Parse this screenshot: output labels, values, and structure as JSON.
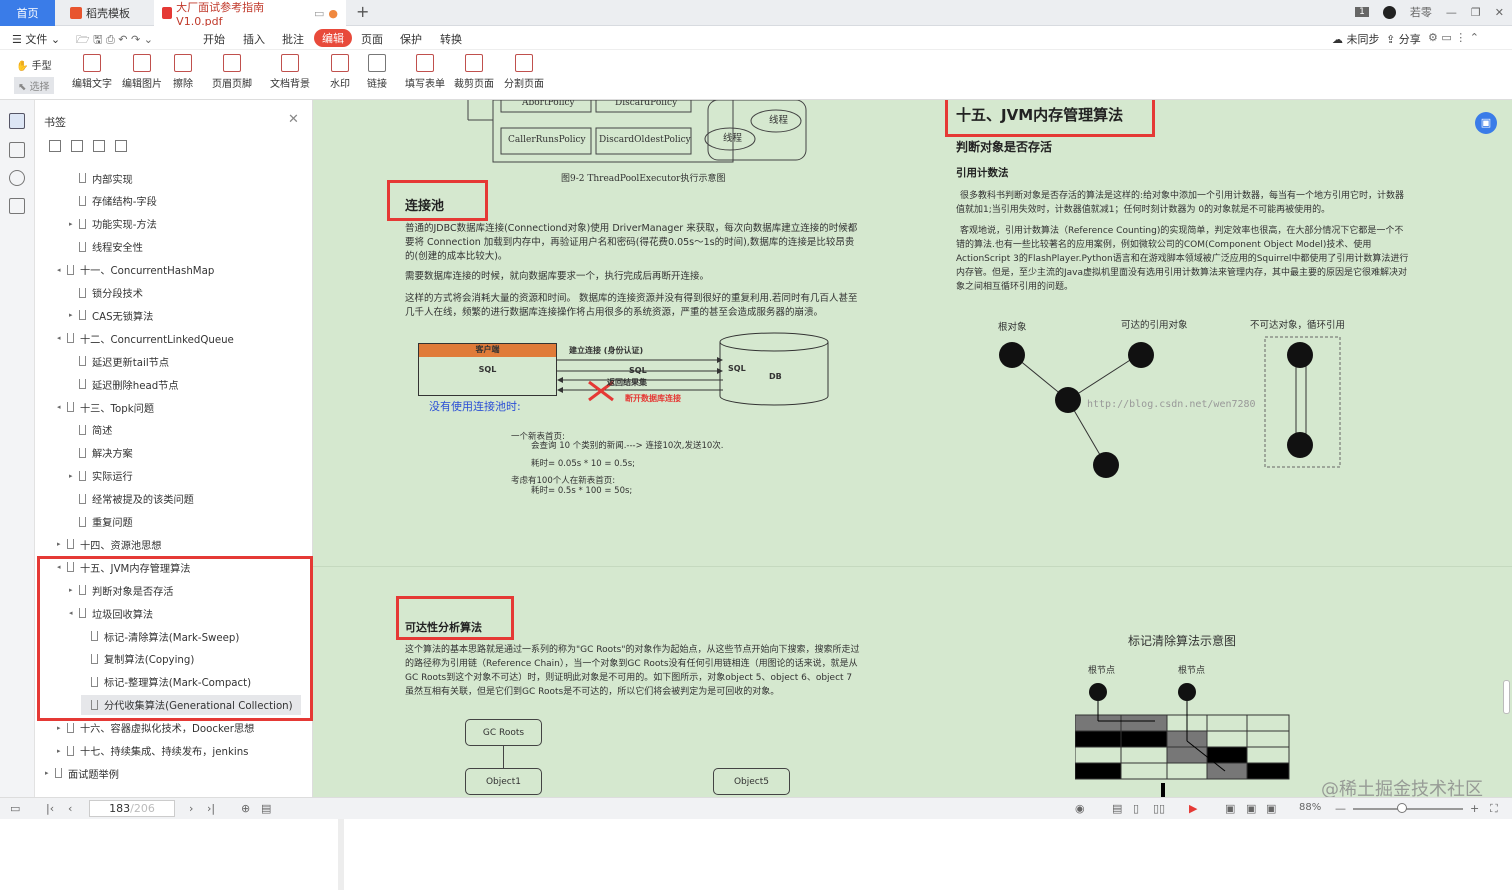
{
  "tabs": {
    "home": "首页",
    "template": "稻壳模板",
    "pdf": "大厂面试参考指南V1.0.pdf",
    "page_badge": "1",
    "user": "若零"
  },
  "menu": {
    "file": "文件",
    "start": "开始",
    "insert": "插入",
    "annotate": "批注",
    "edit": "编辑",
    "page": "页面",
    "protect": "保护",
    "convert": "转换",
    "unsync": "未同步",
    "share": "分享"
  },
  "toolbar": {
    "hand": "手型",
    "select": "选择",
    "edit_text": "编辑文字",
    "edit_image": "编辑图片",
    "erase": "擦除",
    "header_footer": "页眉页脚",
    "doc_bg": "文档背景",
    "watermark": "水印",
    "link": "链接",
    "fill_form": "填写表单",
    "crop": "裁剪页面",
    "split": "分割页面"
  },
  "sidebar": {
    "title": "书签",
    "items": [
      {
        "label": "内部实现",
        "level": 2,
        "arrow": ""
      },
      {
        "label": "存储结构-字段",
        "level": 2,
        "arrow": ""
      },
      {
        "label": "功能实现-方法",
        "level": 2,
        "arrow": "▸"
      },
      {
        "label": "线程安全性",
        "level": 2,
        "arrow": ""
      },
      {
        "label": "十一、ConcurrentHashMap",
        "level": 1,
        "arrow": "◂"
      },
      {
        "label": "锁分段技术",
        "level": 2,
        "arrow": ""
      },
      {
        "label": "CAS无锁算法",
        "level": 2,
        "arrow": "▸"
      },
      {
        "label": "十二、ConcurrentLinkedQueue",
        "level": 1,
        "arrow": "◂"
      },
      {
        "label": "延迟更新tail节点",
        "level": 2,
        "arrow": ""
      },
      {
        "label": "延迟删除head节点",
        "level": 2,
        "arrow": ""
      },
      {
        "label": "十三、Topk问题",
        "level": 1,
        "arrow": "◂"
      },
      {
        "label": "简述",
        "level": 2,
        "arrow": ""
      },
      {
        "label": "解决方案",
        "level": 2,
        "arrow": ""
      },
      {
        "label": "实际运行",
        "level": 2,
        "arrow": "▸"
      },
      {
        "label": "经常被提及的该类问题",
        "level": 2,
        "arrow": ""
      },
      {
        "label": "重复问题",
        "level": 2,
        "arrow": ""
      },
      {
        "label": "十四、资源池思想",
        "level": 1,
        "arrow": "▸"
      },
      {
        "label": "十五、JVM内存管理算法",
        "level": 1,
        "arrow": "◂"
      },
      {
        "label": "判断对象是否存活",
        "level": 2,
        "arrow": "▸"
      },
      {
        "label": "垃圾回收算法",
        "level": 2,
        "arrow": "◂"
      },
      {
        "label": "标记-清除算法(Mark-Sweep)",
        "level": 3,
        "arrow": ""
      },
      {
        "label": "复制算法(Copying)",
        "level": 3,
        "arrow": ""
      },
      {
        "label": "标记-整理算法(Mark-Compact)",
        "level": 3,
        "arrow": ""
      },
      {
        "label": "分代收集算法(Generational Collection)",
        "level": 3,
        "arrow": ""
      },
      {
        "label": "十六、容器虚拟化技术，Doocker思想",
        "level": 1,
        "arrow": "▸"
      },
      {
        "label": "十七、持续集成、持续发布，jenkins",
        "level": 1,
        "arrow": "▸"
      },
      {
        "label": "面试题举例",
        "level": 0,
        "arrow": "▸"
      }
    ]
  },
  "doc": {
    "fig_caption": "图9-2  ThreadPoolExecutor执行示意图",
    "policy_abort": "AbortPolicy",
    "policy_discard": "DiscardPolicy",
    "policy_caller": "CallerRunsPolicy",
    "policy_oldest": "DiscardOldestPolicy",
    "thread1": "线程",
    "thread2": "线程",
    "pool_title": "连接池",
    "pool_p1": "普通的JDBC数据库连接(Connectiond对象)使用 DriverManager 来获取，每次向数据库建立连接的时候都要将 Connection 加载到内存中，再验证用户名和密码(得花费0.05s～1s的时间),数据库的连接是比较昂贵的(创建的成本比较大)。",
    "pool_p2": "需要数据库连接的时候，就向数据库要求一个，执行完成后再断开连接。",
    "pool_p3": "这样的方式将会消耗大量的资源和时间。 数据库的连接资源并没有得到很好的重复利用.若同时有几百人甚至几千人在线，频繁的进行数据库连接操作将占用很多的系统资源，严重的甚至会造成服务器的崩溃。",
    "client": "客户端",
    "sql1": "SQL",
    "sql2": "SQL",
    "sql3": "SQL",
    "db": "DB",
    "connect": "建立连接 (身份认证)",
    "result": "返回结果集",
    "disconnect": "断开数据库连接",
    "no_pool": "没有使用连接池时:",
    "calc1": "一个新表首页:",
    "calc2": "会查询 10 个类别的新闻.---> 连接10次,发送10次.",
    "calc3": "耗时= 0.05s * 10 = 0.5s;",
    "calc4": "考虑有100个人在新表首页:",
    "calc5": "耗时= 0.5s * 100 = 50s;",
    "reach_title": "可达性分析算法",
    "reach_p": "这个算法的基本思路就是通过一系列的称为\"GC Roots\"的对象作为起始点，从这些节点开始向下搜索，搜索所走过的路径称为引用链（Reference Chain），当一个对象到GC Roots没有任何引用链相连（用图论的话来说，就是从GC Roots到这个对象不可达）时，则证明此对象是不可用的。如下图所示，对象object 5、object 6、object 7虽然互相有关联，但是它们到GC Roots是不可达的，所以它们将会被判定为是可回收的对象。",
    "gcroots": "GC Roots",
    "obj1": "Object1",
    "obj5": "Object5",
    "jvm_title": "十五、JVM内存管理算法",
    "alive_title": "判断对象是否存活",
    "refcount_title": "引用计数法",
    "ref_p1": "很多教科书判断对象是否存活的算法是这样的:给对象中添加一个引用计数器，每当有一个地方引用它时，计数器值就加1;当引用失效时，计数器值就减1；任何时刻计数器为 0的对象就是不可能再被使用的。",
    "ref_p2": "客观地说，引用计数算法（Reference Counting)的实现简单，判定效率也很高，在大部分情况下它都是一个不错的算法.也有一些比较著名的应用案例，例如微软公司的COM(Component Object Model)技术、使用ActionScript 3的FlashPlayer.Python语言和在游戏脚本领域被广泛应用的Squirrel中都使用了引用计数算法进行内存管。但是，至少主流的Java虚拟机里面没有选用引用计数算法来管理内存，其中最主要的原因是它很难解决对象之间相互循环引用的问题。",
    "root_obj": "根对象",
    "reachable": "可达的引用对象",
    "unreachable": "不可达对象，循环引用",
    "csdn": "http://blog.csdn.net/wen7280",
    "mark_title": "标记清除算法示意图",
    "root_node1": "根节点",
    "root_node2": "根节点",
    "juejin": "@稀土掘金技术社区"
  },
  "status": {
    "page_current": "183",
    "page_total": "/206",
    "zoom": "88%"
  },
  "colors": {
    "accent": "#3a7ce8",
    "highlight": "#e53935",
    "doc_bg": "#d5e8cf",
    "edit_tab": "#e84a3b"
  }
}
